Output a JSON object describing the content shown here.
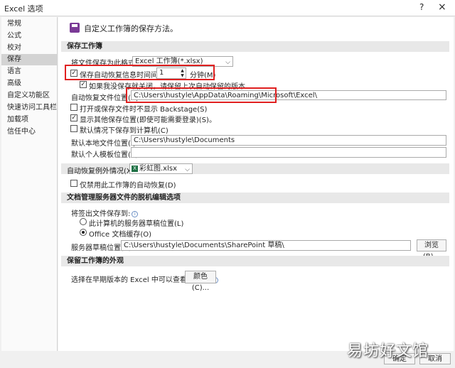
{
  "window": {
    "title": "Excel 选项",
    "help": "?",
    "close": "×"
  },
  "sidebar": {
    "items": [
      {
        "label": "常规"
      },
      {
        "label": "公式"
      },
      {
        "label": "校对"
      },
      {
        "label": "保存",
        "selected": true
      },
      {
        "label": "语言"
      },
      {
        "label": "高级"
      },
      {
        "label": "自定义功能区"
      },
      {
        "label": "快速访问工具栏"
      },
      {
        "label": "加载项"
      },
      {
        "label": "信任中心"
      }
    ]
  },
  "header": {
    "text": "自定义工作簿的保存方法。",
    "icon": "save-disk-icon"
  },
  "save_section": {
    "title": "保存工作簿",
    "format_label": "将文件保存为此格式(F):",
    "format_value": "Excel 工作簿(*.xlsx)",
    "autorecover_label": "保存自动恢复信息时间间隔(A)",
    "autorecover_checked": true,
    "autorecover_minutes": "1",
    "minutes_label": "分钟(M)",
    "keep_last_label": "如果我没保存就关闭，请保留上次自动保留的版本",
    "keep_last_checked": true,
    "ar_location_label": "自动恢复文件位置(R):",
    "ar_location_value": "C:\\Users\\hustyle\\AppData\\Roaming\\Microsoft\\Excel\\",
    "no_backstage_label": "打开或保存文件时不显示 Backstage(S)",
    "no_backstage_checked": false,
    "show_other_label": "显示其他保存位置(即使可能需要登录)(S)。",
    "show_other_checked": true,
    "default_computer_label": "默认情况下保存到计算机(C)",
    "default_computer_checked": false,
    "local_location_label": "默认本地文件位置(I):",
    "local_location_value": "C:\\Users\\hustyle\\Documents",
    "template_location_label": "默认个人模板位置(T):",
    "template_location_value": ""
  },
  "autorecover_exceptions": {
    "label": "自动恢复例外情况(X):",
    "workbook": "彩虹图.xlsx",
    "workbook_icon": "excel-file-icon",
    "disable_label": "仅禁用此工作簿的自动恢复(D)",
    "disable_checked": false
  },
  "offline_section": {
    "title": "文档管理服务器文件的脱机编辑选项",
    "save_to_label": "将签出文件保存到:",
    "opt_server": "此计算机的服务器草稿位置(L)",
    "opt_cache": "Office 文档缓存(O)",
    "selected": "opt_cache",
    "drafts_label": "服务器草稿位置(V):",
    "drafts_value": "C:\\Users\\hustyle\\Documents\\SharePoint 草稿\\",
    "browse_label": "浏览(B)..."
  },
  "appearance_section": {
    "title": "保留工作簿的外观",
    "colors_label": "选择在早期版本的 Excel 中可以查看的颜色:",
    "colors_button": "颜色(C)..."
  },
  "footer": {
    "ok": "确定",
    "cancel": "取消"
  },
  "watermark": "易坊好文馆",
  "colors": {
    "highlight": "#e02020",
    "selected_sidebar": "#d3d3d3",
    "section_bg": "#e8e8e8",
    "accent": "#7a3a96"
  }
}
